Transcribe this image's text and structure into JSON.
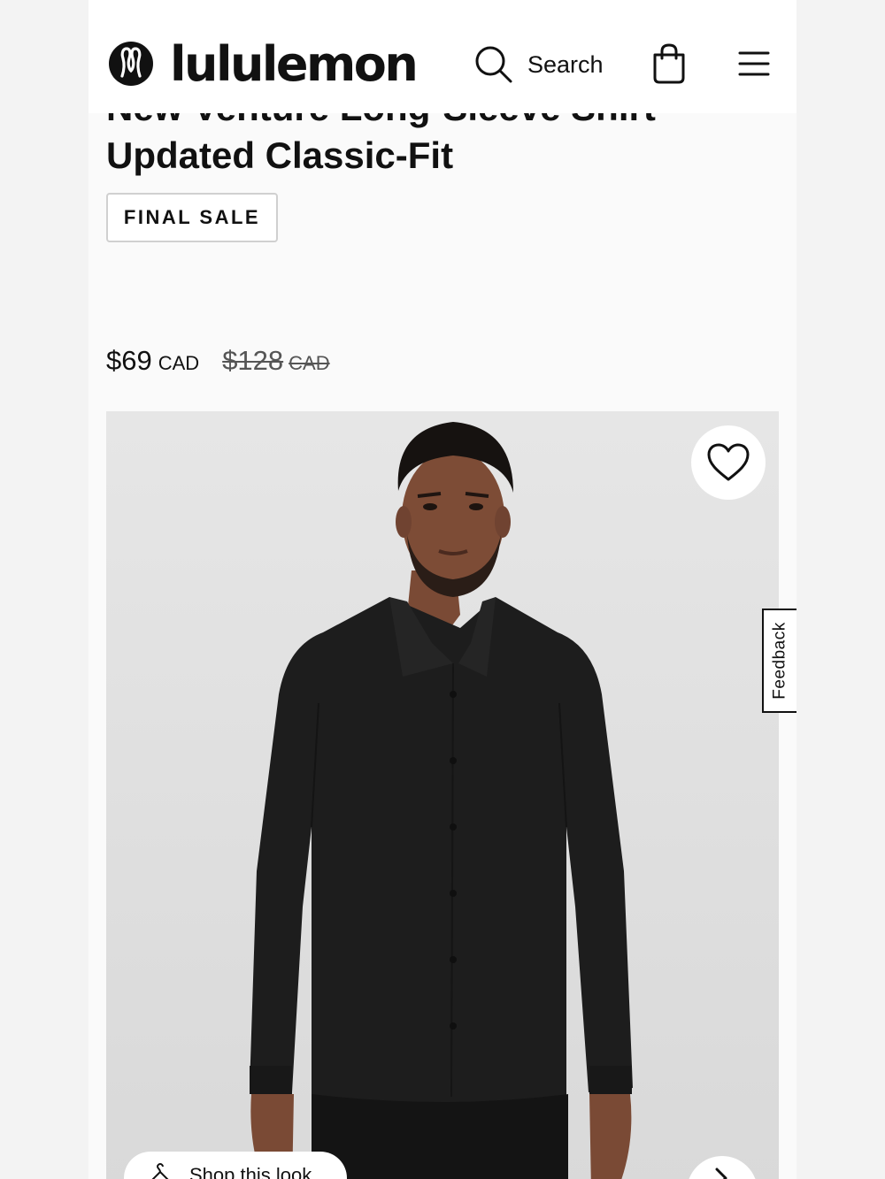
{
  "header": {
    "brand": "lululemon",
    "search_label": "Search"
  },
  "product": {
    "title_line1": "New Venture Long-Sleeve Shirt",
    "title_line2": "Updated Classic-Fit",
    "badge": "FINAL SALE",
    "price_current": "$69",
    "price_current_currency": "CAD",
    "price_original": "$128",
    "price_original_currency": "CAD"
  },
  "gallery": {
    "shop_look_label": "Shop this look"
  },
  "feedback_label": "Feedback",
  "colors": {
    "brand": "#111111",
    "badge_border": "#d0d0d0",
    "image_background": "#e2e2e2",
    "shirt": "#1c1c1c"
  },
  "icons": [
    "lululemon-logo-icon",
    "search-icon",
    "shopping-bag-icon",
    "hamburger-menu-icon",
    "heart-icon",
    "hanger-icon",
    "chevron-right-icon"
  ]
}
